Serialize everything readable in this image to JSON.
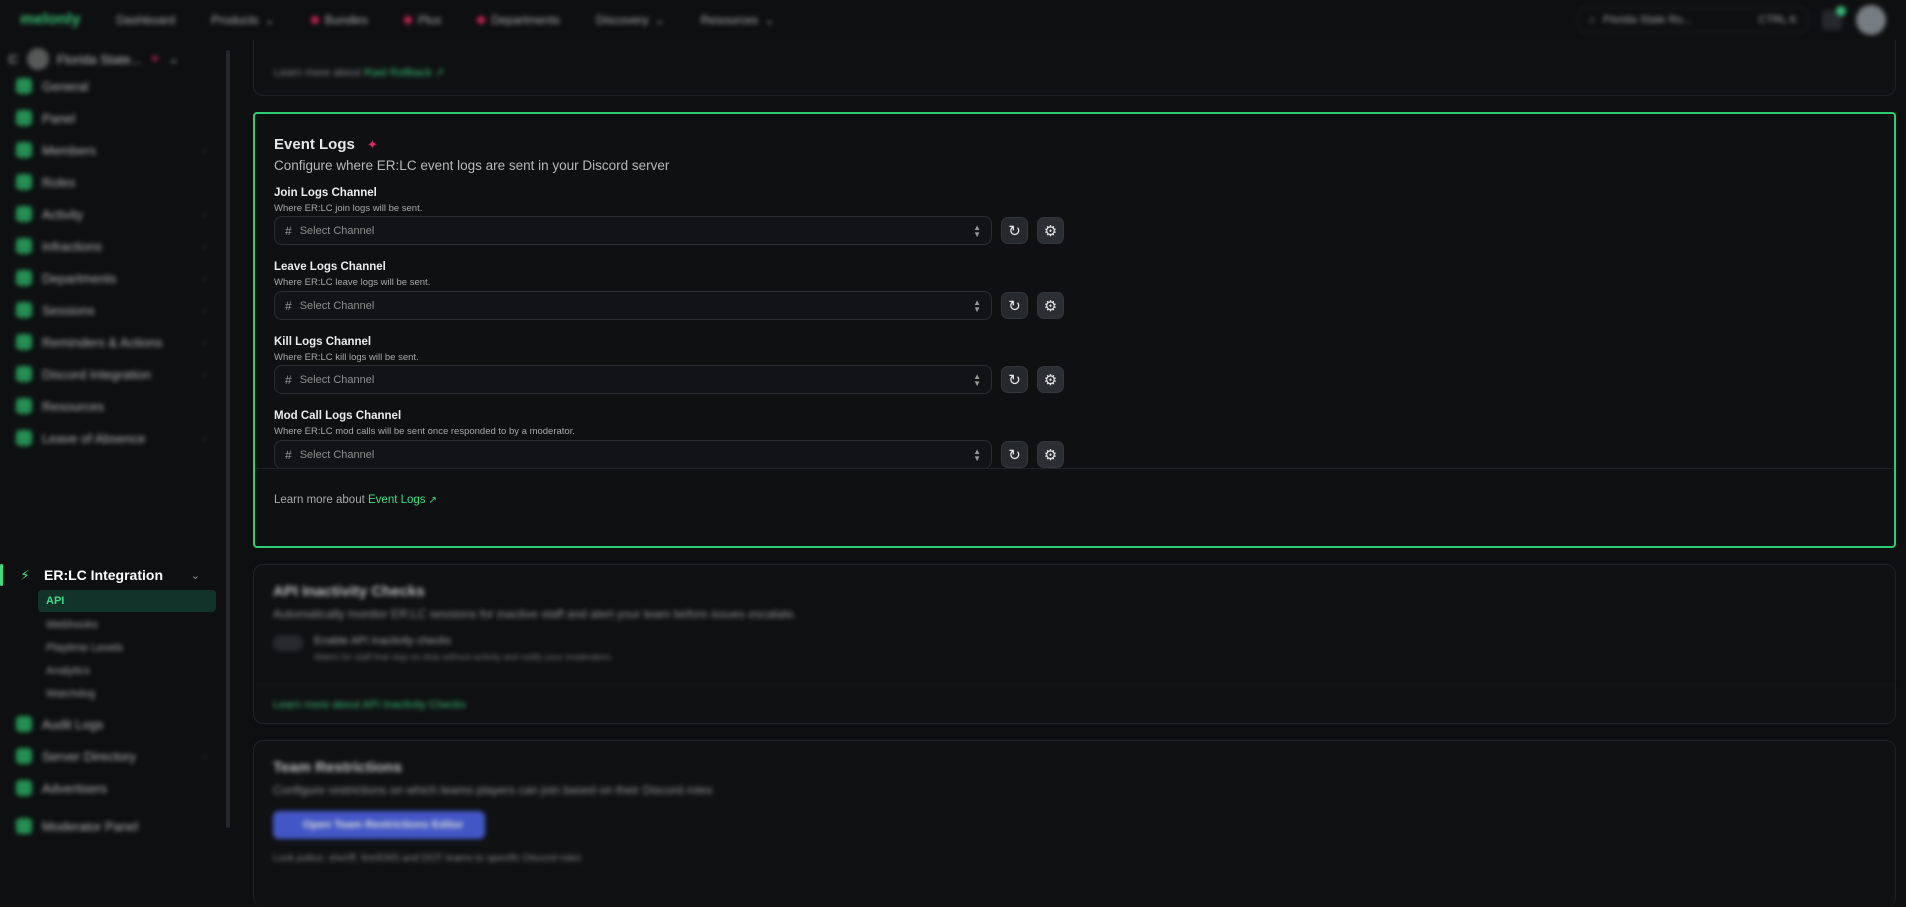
{
  "topbar": {
    "logo": "melonly",
    "nav": [
      "Dashboard",
      "Products",
      "Bundles",
      "Plus",
      "Departments",
      "Discovery",
      "Resources"
    ],
    "server_search": "Florida State Ro...",
    "server_hint": "CTRL K"
  },
  "sidebar": {
    "server_name": "Florida State...",
    "items": [
      "General",
      "Panel",
      "Members",
      "Roles",
      "Activity",
      "Infractions",
      "Departments",
      "Sessions",
      "Reminders & Actions",
      "Discord Integration",
      "Resources",
      "Leave of Absence"
    ],
    "active_section": "ER:LC Integration",
    "sub_items": [
      "API",
      "Webhooks",
      "Playtime Levels",
      "Analytics",
      "Watchdog"
    ],
    "active_sub": "API",
    "after_items": [
      "Audit Logs",
      "Server Directory",
      "Advertisers"
    ],
    "bottom_item": "Moderator Panel"
  },
  "raid_card": {
    "learn_prefix": "Learn more about",
    "learn_link": "Raid Rollback"
  },
  "event_logs": {
    "title": "Event Logs",
    "subtitle": "Configure where ER:LC event logs are sent in your Discord server",
    "fields": [
      {
        "label": "Join Logs Channel",
        "hint": "Where ER:LC join logs will be sent.",
        "placeholder": "Select Channel"
      },
      {
        "label": "Leave Logs Channel",
        "hint": "Where ER:LC leave logs will be sent.",
        "placeholder": "Select Channel"
      },
      {
        "label": "Kill Logs Channel",
        "hint": "Where ER:LC kill logs will be sent.",
        "placeholder": "Select Channel"
      },
      {
        "label": "Mod Call Logs Channel",
        "hint": "Where ER:LC mod calls will be sent once responded to by a moderator.",
        "placeholder": "Select Channel"
      }
    ],
    "learn_prefix": "Learn more about",
    "learn_link": "Event Logs"
  },
  "api_inactivity": {
    "title": "API Inactivity Checks",
    "subtitle": "Automatically monitor ER:LC sessions for inactive staff and alert your team before issues escalate.",
    "toggle_label": "Enable API inactivity checks",
    "toggle_hint": "Watch for staff that stay on duty without activity and notify your moderators.",
    "learn_prefix": "Learn more about",
    "learn_link": "API Inactivity Checks"
  },
  "team_restrictions": {
    "title": "Team Restrictions",
    "subtitle": "Configure restrictions on which teams players can join based on their Discord roles",
    "button": "Open Team Restrictions Editor",
    "hint": "Lock police, sheriff, fire/EMS and DOT teams to specific Discord roles"
  },
  "colors": {
    "accent": "#2ecc71",
    "pro": "#e0285f",
    "bg": "#0e0f11"
  }
}
